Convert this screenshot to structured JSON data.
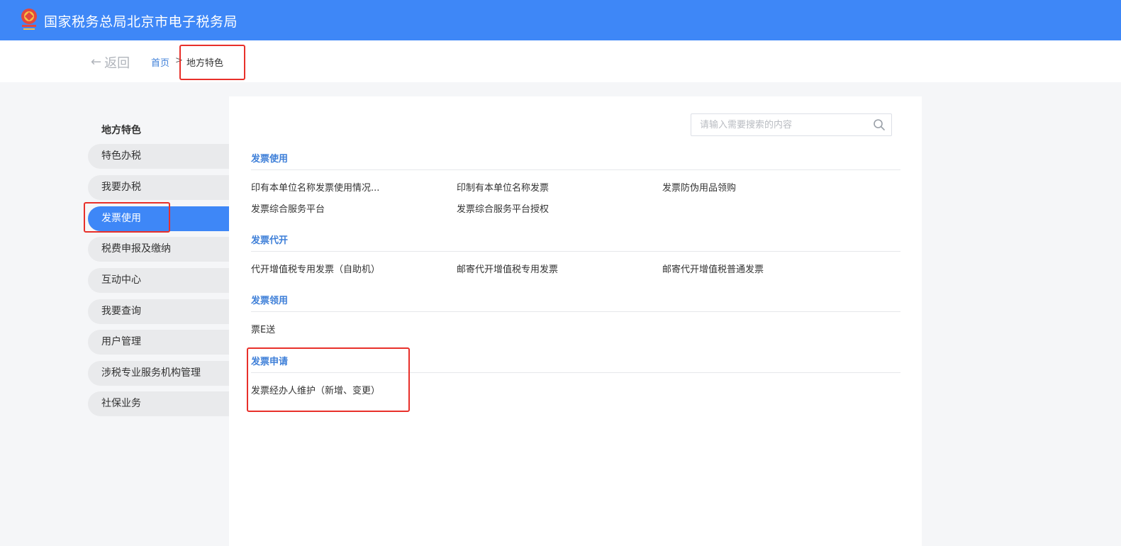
{
  "header": {
    "title": "国家税务总局北京市电子税务局"
  },
  "breadcrumb": {
    "back_label": "返回",
    "home": "首页",
    "separator": ">",
    "current": "地方特色"
  },
  "sidebar": {
    "title": "地方特色",
    "items": [
      {
        "label": "特色办税"
      },
      {
        "label": "我要办税"
      },
      {
        "label": "发票使用",
        "active": true
      },
      {
        "label": "税费申报及缴纳"
      },
      {
        "label": "互动中心"
      },
      {
        "label": "我要查询"
      },
      {
        "label": "用户管理"
      },
      {
        "label": "涉税专业服务机构管理"
      },
      {
        "label": "社保业务"
      }
    ]
  },
  "search": {
    "placeholder": "请输入需要搜索的内容",
    "value": ""
  },
  "sections": [
    {
      "title": "发票使用",
      "links": [
        "印有本单位名称发票使用情况...",
        "印制有本单位名称发票",
        "发票防伪用品领购",
        "发票综合服务平台",
        "发票综合服务平台授权"
      ]
    },
    {
      "title": "发票代开",
      "links": [
        "代开增值税专用发票（自助机）",
        "邮寄代开增值税专用发票",
        "邮寄代开增值税普通发票"
      ]
    },
    {
      "title": "发票领用",
      "links": [
        "票E送"
      ]
    },
    {
      "title": "发票申请",
      "links": [
        "发票经办人维护（新增、变更）"
      ]
    }
  ],
  "colors": {
    "brand": "#3e87f7",
    "link_blue": "#3e7fd8",
    "highlight_red": "#e8302a"
  }
}
